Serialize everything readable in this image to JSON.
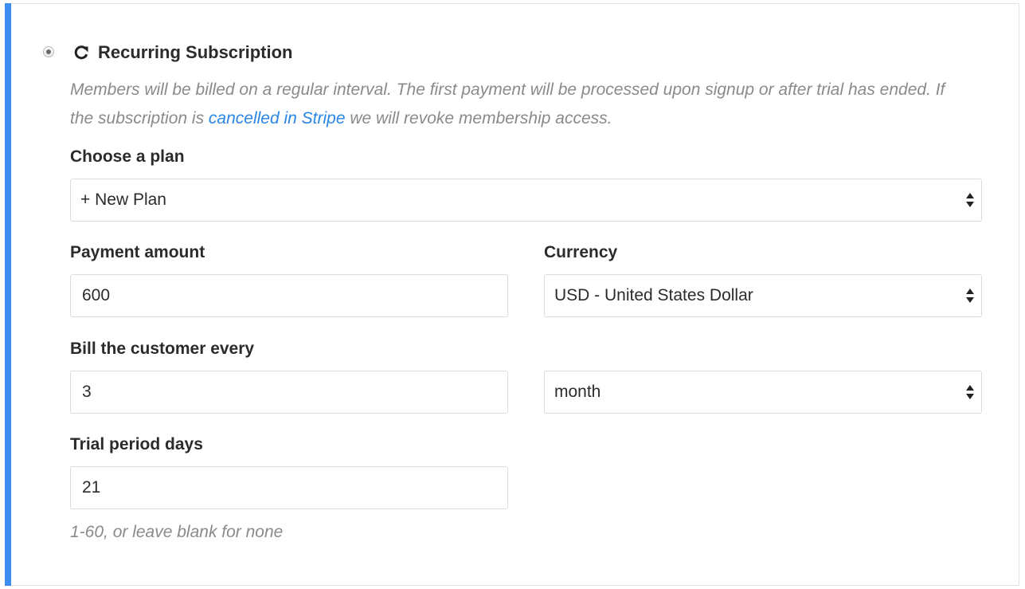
{
  "option": {
    "title": "Recurring Subscription",
    "selected": true,
    "icon": "refresh-icon",
    "description_before": "Members will be billed on a regular interval. The first payment will be processed upon signup or after trial has ended. If the subscription is ",
    "description_link": "cancelled in Stripe",
    "description_after": " we will revoke membership access."
  },
  "plan": {
    "label": "Choose a plan",
    "value": "+ New Plan"
  },
  "payment_amount": {
    "label": "Payment amount",
    "value": "600"
  },
  "currency": {
    "label": "Currency",
    "value": "USD - United States Dollar"
  },
  "billing": {
    "label": "Bill the customer every",
    "count": "3",
    "interval": "month"
  },
  "trial": {
    "label": "Trial period days",
    "value": "21",
    "help": "1-60, or leave blank for none"
  },
  "colors": {
    "accent": "#3d8ef0",
    "link": "#2a86e6",
    "muted_text": "#8a8a8a"
  }
}
